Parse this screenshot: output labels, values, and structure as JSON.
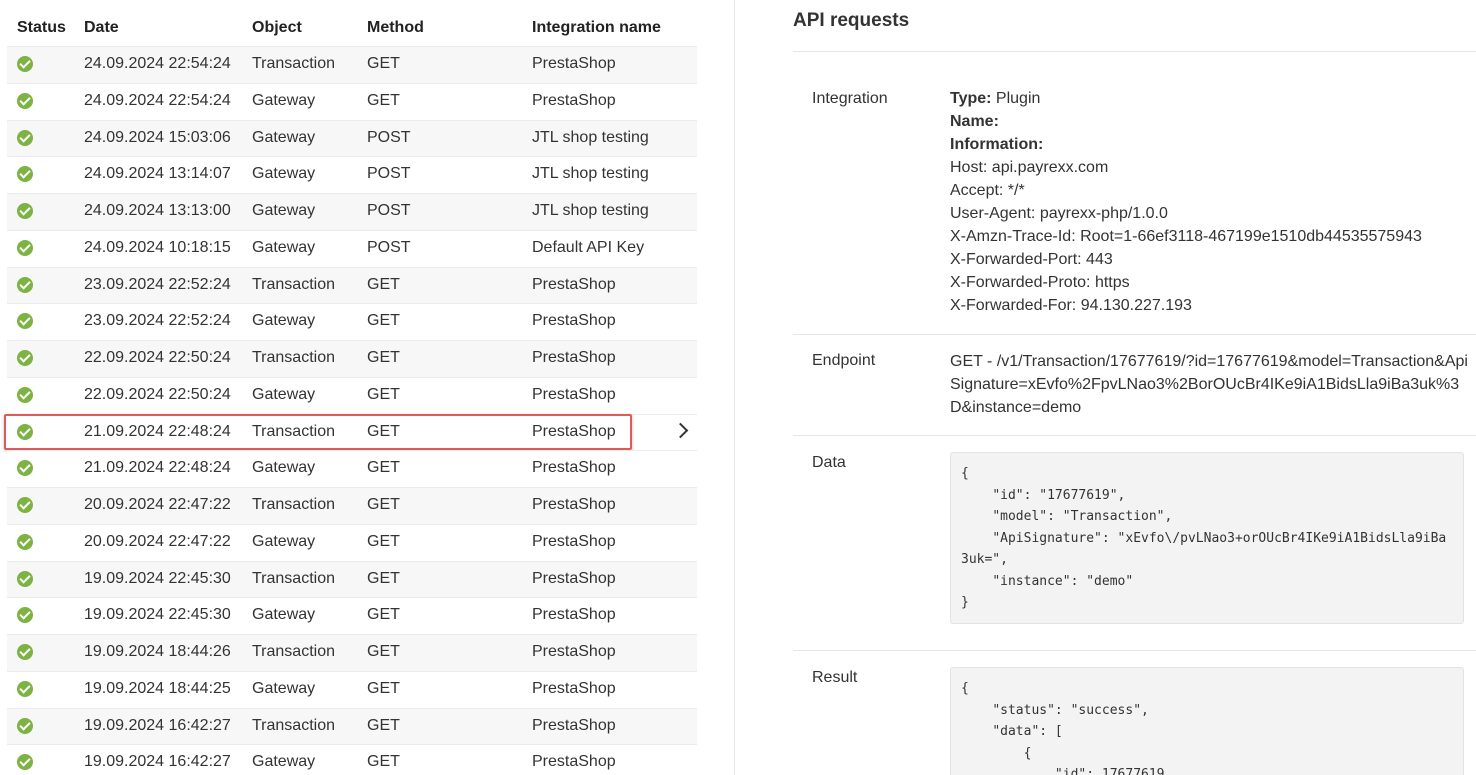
{
  "list": {
    "headers": {
      "status": "Status",
      "date": "Date",
      "object": "Object",
      "method": "Method",
      "integration": "Integration name"
    },
    "selected_index": 10,
    "rows": [
      {
        "date": "24.09.2024 22:54:24",
        "object": "Transaction",
        "method": "GET",
        "integration": "PrestaShop"
      },
      {
        "date": "24.09.2024 22:54:24",
        "object": "Gateway",
        "method": "GET",
        "integration": "PrestaShop"
      },
      {
        "date": "24.09.2024 15:03:06",
        "object": "Gateway",
        "method": "POST",
        "integration": "JTL shop testing"
      },
      {
        "date": "24.09.2024 13:14:07",
        "object": "Gateway",
        "method": "POST",
        "integration": "JTL shop testing"
      },
      {
        "date": "24.09.2024 13:13:00",
        "object": "Gateway",
        "method": "POST",
        "integration": "JTL shop testing"
      },
      {
        "date": "24.09.2024 10:18:15",
        "object": "Gateway",
        "method": "POST",
        "integration": "Default API Key"
      },
      {
        "date": "23.09.2024 22:52:24",
        "object": "Transaction",
        "method": "GET",
        "integration": "PrestaShop"
      },
      {
        "date": "23.09.2024 22:52:24",
        "object": "Gateway",
        "method": "GET",
        "integration": "PrestaShop"
      },
      {
        "date": "22.09.2024 22:50:24",
        "object": "Transaction",
        "method": "GET",
        "integration": "PrestaShop"
      },
      {
        "date": "22.09.2024 22:50:24",
        "object": "Gateway",
        "method": "GET",
        "integration": "PrestaShop"
      },
      {
        "date": "21.09.2024 22:48:24",
        "object": "Transaction",
        "method": "GET",
        "integration": "PrestaShop"
      },
      {
        "date": "21.09.2024 22:48:24",
        "object": "Gateway",
        "method": "GET",
        "integration": "PrestaShop"
      },
      {
        "date": "20.09.2024 22:47:22",
        "object": "Transaction",
        "method": "GET",
        "integration": "PrestaShop"
      },
      {
        "date": "20.09.2024 22:47:22",
        "object": "Gateway",
        "method": "GET",
        "integration": "PrestaShop"
      },
      {
        "date": "19.09.2024 22:45:30",
        "object": "Transaction",
        "method": "GET",
        "integration": "PrestaShop"
      },
      {
        "date": "19.09.2024 22:45:30",
        "object": "Gateway",
        "method": "GET",
        "integration": "PrestaShop"
      },
      {
        "date": "19.09.2024 18:44:26",
        "object": "Transaction",
        "method": "GET",
        "integration": "PrestaShop"
      },
      {
        "date": "19.09.2024 18:44:25",
        "object": "Gateway",
        "method": "GET",
        "integration": "PrestaShop"
      },
      {
        "date": "19.09.2024 16:42:27",
        "object": "Transaction",
        "method": "GET",
        "integration": "PrestaShop"
      },
      {
        "date": "19.09.2024 16:42:27",
        "object": "Gateway",
        "method": "GET",
        "integration": "PrestaShop"
      }
    ],
    "status_color": "#7cb342",
    "selection_color": "#e05a5a"
  },
  "detail": {
    "title": "API requests",
    "integration": {
      "label": "Integration",
      "type_key": "Type:",
      "type_value": " Plugin",
      "name_key": "Name:",
      "information_key": "Information:",
      "lines": [
        "Host: api.payrexx.com",
        "Accept: */*",
        "User-Agent: payrexx-php/1.0.0",
        "X-Amzn-Trace-Id: Root=1-66ef3118-467199e1510db44535575943",
        "X-Forwarded-Port: 443",
        "X-Forwarded-Proto: https",
        "X-Forwarded-For: 94.130.227.193"
      ]
    },
    "endpoint": {
      "label": "Endpoint",
      "value": "GET - /v1/Transaction/17677619/?id=17677619&model=Transaction&ApiSignature=xEvfo%2FpvLNao3%2BorOUcBr4IKe9iA1BidsLla9iBa3uk%3D&instance=demo"
    },
    "data": {
      "label": "Data",
      "code": "{\n    \"id\": \"17677619\",\n    \"model\": \"Transaction\",\n    \"ApiSignature\": \"xEvfo\\/pvLNao3+orOUcBr4IKe9iA1BidsLla9iBa3uk=\",\n    \"instance\": \"demo\"\n}"
    },
    "result": {
      "label": "Result",
      "code": "{\n    \"status\": \"success\",\n    \"data\": [\n        {\n            \"id\": 17677619,"
    }
  }
}
